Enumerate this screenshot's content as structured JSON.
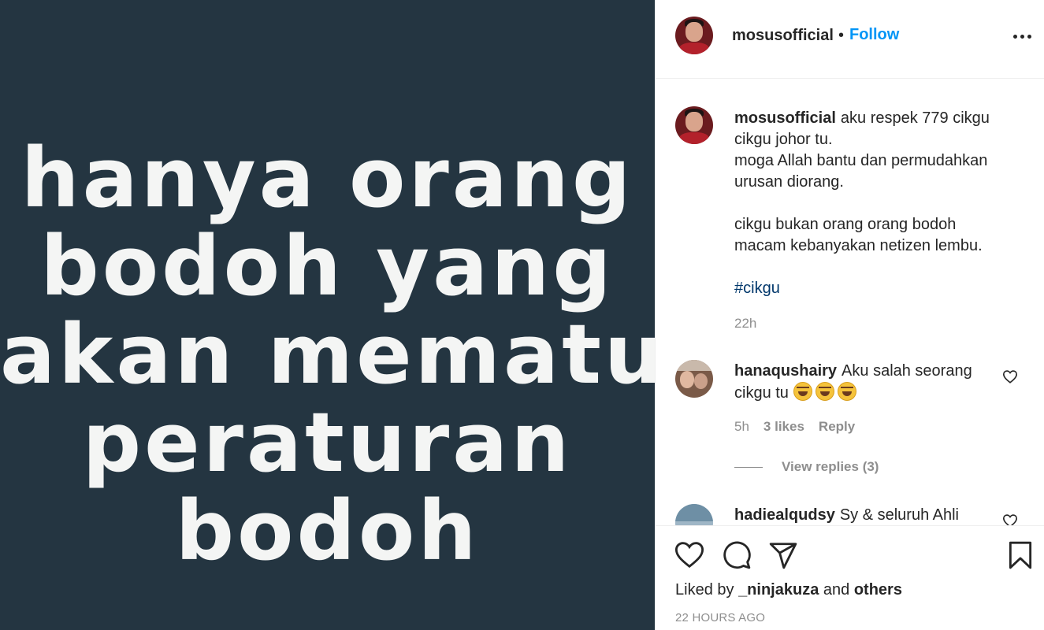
{
  "image": {
    "lines": [
      "hanya orang",
      "bodoh yang",
      "akan mematuhi",
      "peraturan",
      "bodoh"
    ],
    "background": "#243541",
    "text_color": "#f4f5f4"
  },
  "header": {
    "username": "mosusofficial",
    "separator": "•",
    "follow_label": "Follow",
    "more_icon": "more-horizontal-icon"
  },
  "caption": {
    "username": "mosusofficial",
    "lines": [
      "aku respek 779 cikgu",
      "cikgu johor tu.",
      "moga Allah bantu dan permudahkan",
      "urusan diorang.",
      "",
      "cikgu bukan orang orang bodoh",
      "macam kebanyakan netizen lembu."
    ],
    "hashtag": "#cikgu",
    "time": "22h"
  },
  "comments": [
    {
      "username": "hanaqushairy",
      "text_line1": "Aku salah seorang",
      "text_line2": "cikgu tu",
      "emoji": "rolling-on-floor-laughing-emoji",
      "time": "5h",
      "likes": "3 likes",
      "reply_label": "Reply",
      "view_replies": "View replies (3)"
    },
    {
      "username": "hadiealqudsy",
      "text_line1": "Sy & seluruh Ahli"
    }
  ],
  "actions": {
    "like_icon": "heart-icon",
    "comment_icon": "comment-icon",
    "share_icon": "send-icon",
    "save_icon": "bookmark-icon"
  },
  "likes": {
    "prefix": "Liked by",
    "user": "_ninjakuza",
    "conj": "and",
    "others": "others"
  },
  "timestamp": "22 HOURS AGO",
  "colors": {
    "link_blue": "#0095f6",
    "hashtag": "#00376b",
    "muted": "#8e8e8e"
  }
}
